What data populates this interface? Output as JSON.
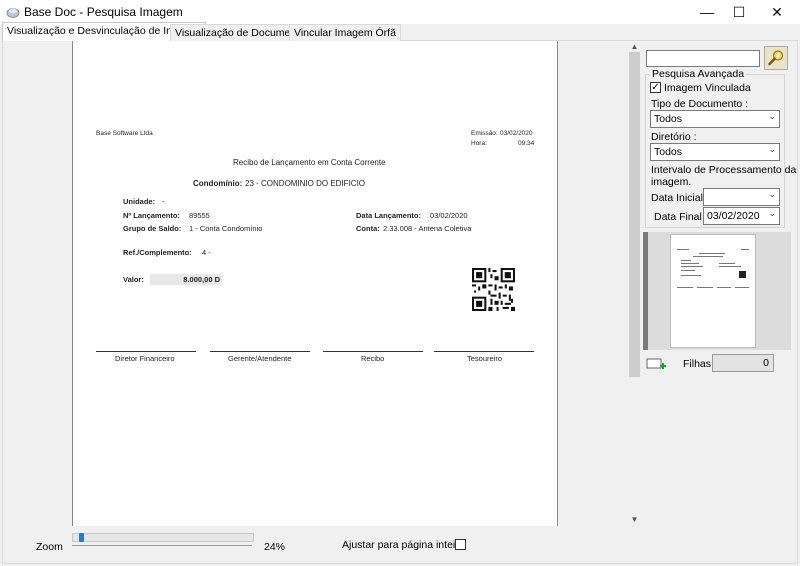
{
  "window": {
    "title": "Base Doc - Pesquisa Imagem",
    "minimize": "—",
    "maximize": "☐",
    "close": "✕"
  },
  "tabs": [
    {
      "label": "Visualização e Desvinculação de Imagem",
      "active": true
    },
    {
      "label": "Visualização de Documentos",
      "active": false
    },
    {
      "label": "Vincular Imagem Órfã",
      "active": false
    }
  ],
  "document": {
    "company": "Base Software Ltda",
    "emissao_label": "Emissão:",
    "emissao_value": "03/02/2020",
    "hora_label": "Hora:",
    "hora_value": "09:34",
    "heading": "Recibo de Lançamento em Conta Corrente",
    "condominio_label": "Condomínio:",
    "condominio_value": "23 - CONDOMINIO DO EDIFICIO",
    "unidade_label": "Unidade:",
    "unidade_value": "-",
    "lancamento_label": "Nº Lançamento:",
    "lancamento_value": "89555",
    "data_lanc_label": "Data Lançamento:",
    "data_lanc_value": "03/02/2020",
    "grupo_label": "Grupo de Saldo:",
    "grupo_value": "1 - Conta Condomínio",
    "conta_label": "Conta:",
    "conta_value": "2.33.008 - Antena Coletiva",
    "ref_label": "Ref./Complemento:",
    "ref_value": "4 -",
    "valor_label": "Valor:",
    "valor_value": "8.000,00 D",
    "signatures": [
      "Diretor Financeiro",
      "Gerente/Atendente",
      "Recibo",
      "Tesoureiro"
    ]
  },
  "zoom": {
    "label": "Zoom",
    "value_text": "24%",
    "fit_label": "Ajustar para página inteira",
    "fit_checked": false
  },
  "search": {
    "value": "",
    "group_title": "Pesquisa Avançada",
    "imagem_vinculada_label": "Imagem Vinculada",
    "imagem_vinculada_checked": true,
    "tipo_label": "Tipo de Documento :",
    "tipo_value": "Todos",
    "diretorio_label": "Diretório :",
    "diretorio_value": "Todos",
    "intervalo_label_1": "Intervalo de Processamento da",
    "intervalo_label_2": "imagem.",
    "data_inicial_label": "Data Inicial :",
    "data_inicial_value": "",
    "data_final_label": "Data Final :",
    "data_final_value": "03/02/2020"
  },
  "thumbnails": {
    "filhas_label": "Filhas:",
    "filhas_value": "0"
  }
}
